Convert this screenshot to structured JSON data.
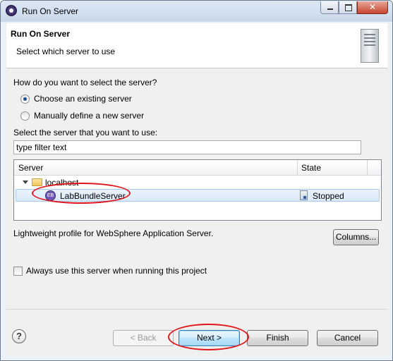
{
  "window": {
    "title": "Run On Server",
    "close_glyph": "✕"
  },
  "header": {
    "title": "Run On Server",
    "subtitle": "Select which server to use",
    "icon": "server-icon"
  },
  "selection": {
    "question": "How do you want to select the server?",
    "options": [
      {
        "label": "Choose an existing server",
        "checked": true
      },
      {
        "label": "Manually define a new server",
        "checked": false
      }
    ],
    "select_label": "Select the server that you want to use:"
  },
  "filter": {
    "value": "type filter text"
  },
  "table": {
    "columns": [
      "Server",
      "State"
    ],
    "host": "localhost",
    "servers": [
      {
        "name": "LabBundleServer",
        "state": "Stopped",
        "icon_text": "EB"
      }
    ]
  },
  "description": "Lightweight profile for WebSphere Application Server.",
  "buttons": {
    "columns": "Columns...",
    "back": "< Back",
    "next": "Next >",
    "finish": "Finish",
    "cancel": "Cancel",
    "help": "?"
  },
  "always_use": {
    "label": "Always use this server when running this project",
    "checked": false
  },
  "colors": {
    "annotation_oval": "#e0161b",
    "selection_row": "#d9e9f9"
  }
}
